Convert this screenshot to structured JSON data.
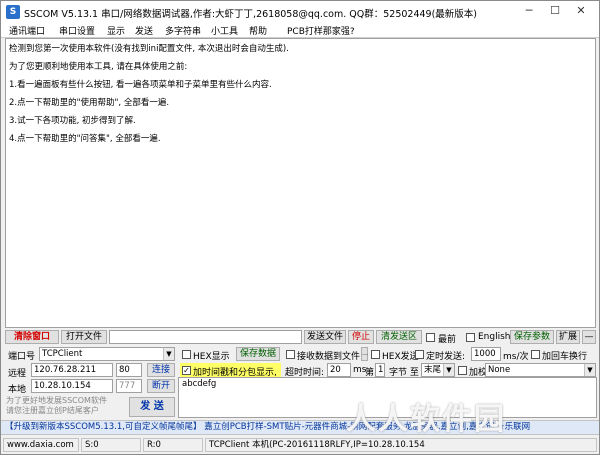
{
  "window": {
    "title": "SSCOM V5.13.1 串口/网络数据调试器,作者:大虾丁丁,2618058@qq.com. QQ群：52502449(最新版本)",
    "app_icon_glyph": "S"
  },
  "menu": [
    "通讯端口",
    "串口设置",
    "显示",
    "发送",
    "多字符串",
    "小工具",
    "帮助",
    "PCB打样那家强?"
  ],
  "output_lines": [
    "检测到您第一次使用本软件(没有找到ini配置文件, 本次退出时会自动生成).",
    "为了您更顺利地使用本工具, 请在具体使用之前:",
    "1.看一遍面板有些什么按钮, 看一遍各项菜单和子菜单里有些什么内容.",
    "2.点一下帮助里的\"使用帮助\", 全部看一遍.",
    "3.试一下各项功能, 初步得到了解.",
    "4.点一下帮助里的\"问答集\", 全部看一遍."
  ],
  "toolbar": {
    "clear_window": "清除窗口",
    "open_file": "打开文件",
    "file_path": "",
    "send_file": "发送文件",
    "stop": "停止",
    "clear_send": "清发送区",
    "topmost": "最前",
    "english": "English",
    "save_params": "保存参数",
    "expand": "扩展",
    "collapse": "—"
  },
  "port": {
    "label": "端口号",
    "value": "TCPClient",
    "remote_label": "远程",
    "remote_ip": "120.76.28.211",
    "remote_port": "80",
    "connect": "连接",
    "local_label": "本地",
    "local_ip": "10.28.10.154",
    "local_port": "777",
    "disconnect": "断开"
  },
  "options": {
    "hex_display": "HEX显示",
    "save_data": "保存数据",
    "receive_to_file": "接收数据到文件",
    "hex_send": "HEX发送",
    "timed_send": "定时发送:",
    "interval": "1000",
    "interval_unit": "ms/次",
    "add_crlf": "加回车换行",
    "add_timestamp": "加时间戳和分包显示,",
    "timeout_label": "超时时间:",
    "timeout_value": "20",
    "timeout_unit": "ms",
    "byte_prefix": "第",
    "byte_index": "1",
    "byte_label": "字节 至",
    "byte_end": "末尾",
    "checksum_label": "加校验",
    "checksum_value": "None"
  },
  "send": {
    "text": "abcdefg",
    "button": "发 送",
    "tip": "为了更好地发展SSCOM软件\n请您注册嘉立创P结尾客户"
  },
  "ad_text": "【升级到新版本SSCOM5.13.1,可自定义帧尾帧尾】  嘉立创PCB打样-SMT贴片-元器件商城-钢网配套服务  龙服务器,嘉立创,嘉立创 ★乐联网",
  "status": {
    "website": "www.daxia.com",
    "sent": "S:0",
    "received": "R:0",
    "connection": "TCPClient 本机(PC-20161118RLFY,IP=10.28.10.154"
  },
  "watermark": "人人软件园"
}
